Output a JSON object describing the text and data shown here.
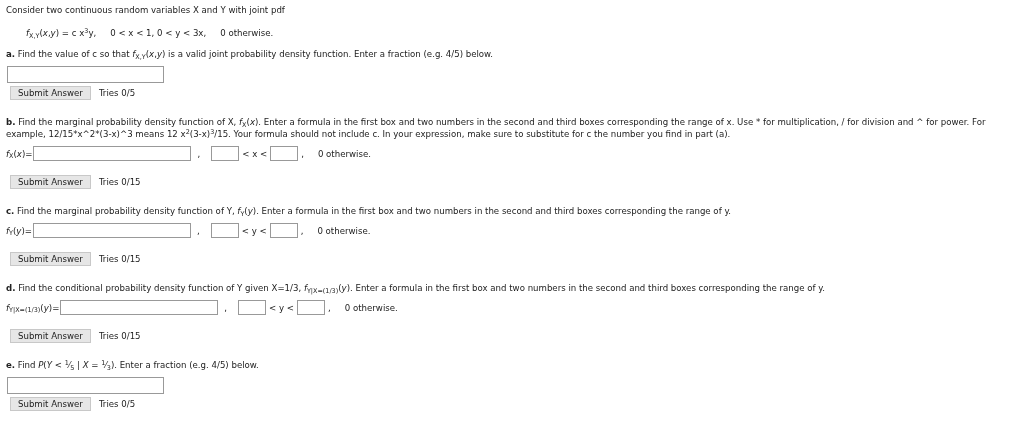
{
  "intro": "Consider two continuous random variables X and Y with joint pdf",
  "pdf": {
    "formula": "*f*$_{X,Y}$(*x*,*y*) = c x$^{3}$y,",
    "range": "0 < x < 1, 0 < y < 3x,",
    "otherwise": "0 otherwise."
  },
  "parts": [
    {
      "kind": "fraction",
      "label": "a.",
      "text": "Find the value of c so that *f*$_{X,Y}$(*x*,*y*) is a valid joint probability density function. Enter a fraction (e.g. 4/5) below.",
      "button": "Submit Answer",
      "tries": "Tries 0/5"
    },
    {
      "kind": "formula",
      "label": "b.",
      "text": "Find the marginal probability density function of X, *f*$_{X}$(*x*). Enter a formula in the first box and two numbers in the second and third boxes corresponding the range of x. Use * for multiplication, / for division and ^ for power. For example, 12/15*x^2*(3-x)^3 means 12 x$^{2}$(3-x)$^{3}$/15. Your formula should not include c. In your expression, make sure to substitute for c the number you find in part (a).",
      "lhs": "*f*$_{X}$(*x*)=",
      "separators": [
        ",",
        ","
      ],
      "range_mid": "< x <",
      "otherwise": "0 otherwise.",
      "button": "Submit Answer",
      "tries": "Tries 0/15"
    },
    {
      "kind": "formula",
      "label": "c.",
      "text": "Find the marginal probability density function of Y, *f*$_{Y}$(*y*). Enter a formula in the first box and two numbers in the second and third boxes corresponding the range of y.",
      "lhs": "*f*$_{Y}$(*y*)=",
      "separators": [
        ",",
        ","
      ],
      "range_mid": "< y <",
      "otherwise": "0 otherwise.",
      "button": "Submit Answer",
      "tries": "Tries 0/15"
    },
    {
      "kind": "formula",
      "label": "d.",
      "text": "Find the conditional probability density function of Y given X=1/3, *f*$_{Y|X=(1/3)}$(*y*). Enter a formula in the first box and two numbers in the second and third boxes corresponding the range of y.",
      "lhs": "*f*$_{Y|X=(1/3)}$(*y*)=",
      "separators": [
        ",",
        ","
      ],
      "range_mid": "< y <",
      "otherwise": "0 otherwise.",
      "button": "Submit Answer",
      "tries": "Tries 0/15"
    },
    {
      "kind": "fraction",
      "label": "e.",
      "text": "Find *P*(*Y* < $^{1}$⁄$_{5}$ | *X* = $^{1}$⁄$_{3}$). Enter a fraction (e.g. 4/5) below.",
      "button": "Submit Answer",
      "tries": "Tries 0/5"
    }
  ]
}
